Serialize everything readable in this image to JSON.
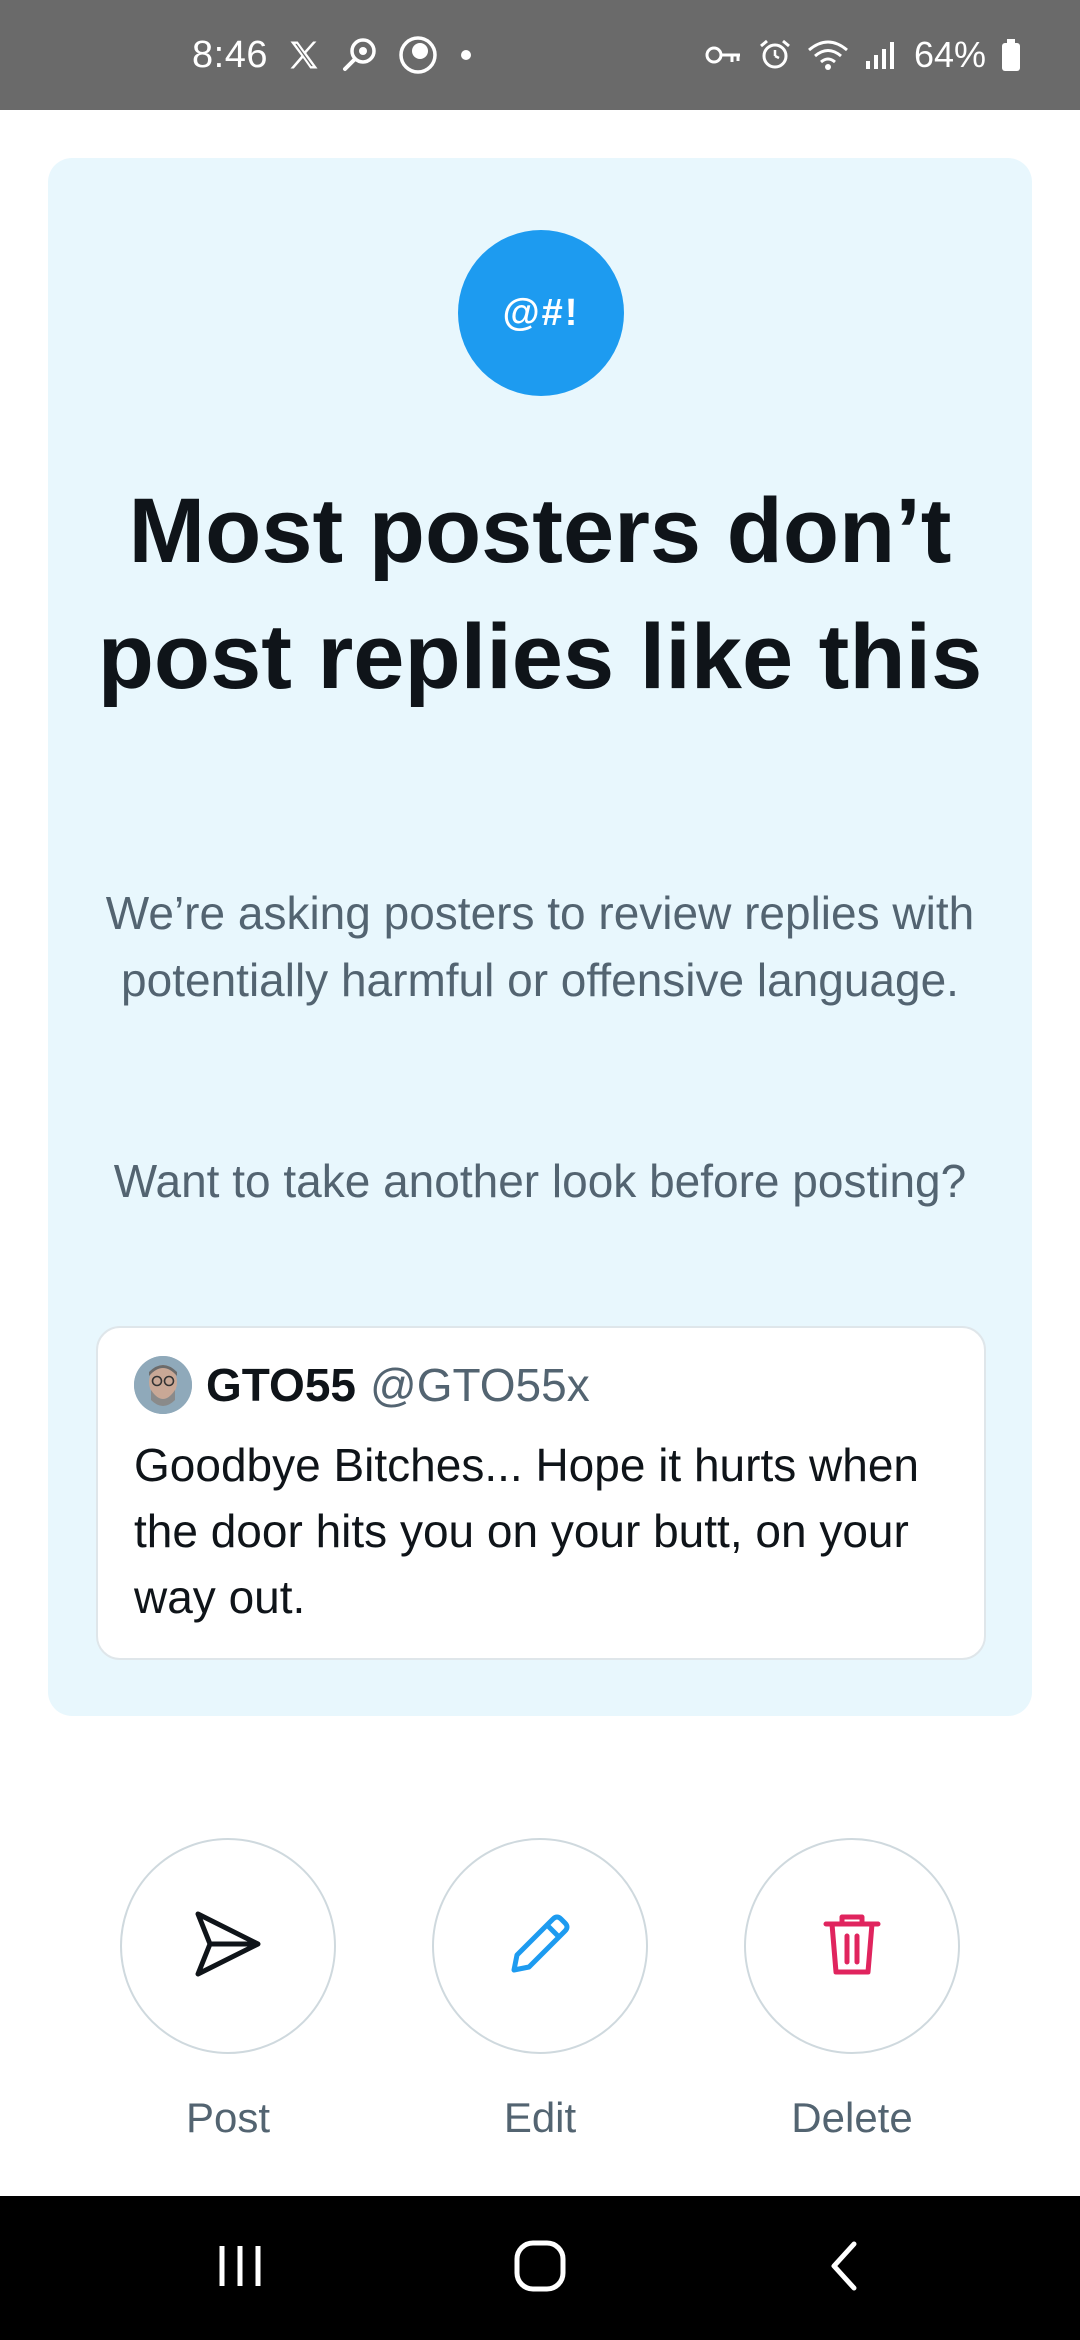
{
  "status_bar": {
    "time": "8:46",
    "battery": "64%",
    "icons": [
      "x-logo-icon",
      "search-app-icon",
      "circle-app-icon",
      "dot-icon",
      "key-icon",
      "alarm-icon",
      "wifi-icon",
      "signal-icon",
      "battery-icon"
    ]
  },
  "card": {
    "badge_text": "@#!",
    "headline": "Most posters don’t post replies like this",
    "body_1": "We’re asking posters to review replies with potentially harmful or offensive language.",
    "body_2": "Want to take another look before posting?",
    "reply": {
      "name": "GTO55",
      "handle": "@GTO55x",
      "text": "Goodbye Bitches... Hope it hurts when the door hits you on your butt, on your way out."
    }
  },
  "actions": {
    "post_label": "Post",
    "edit_label": "Edit",
    "delete_label": "Delete"
  },
  "colors": {
    "accent": "#1d9bf0",
    "card_bg": "#e8f7fd",
    "delete": "#e0245e",
    "text_primary": "#0f1419",
    "text_secondary": "#536471"
  },
  "nav_icons": [
    "recents-icon",
    "home-icon",
    "back-icon"
  ]
}
